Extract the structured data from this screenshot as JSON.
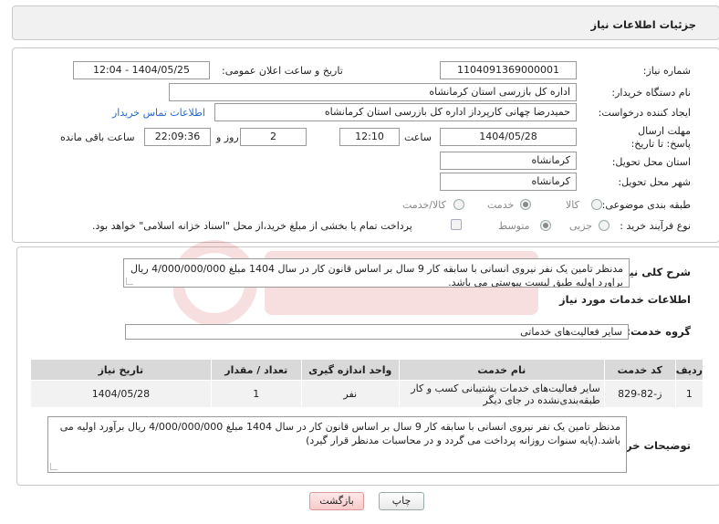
{
  "header": {
    "title": "جزئیات اطلاعات نیاز"
  },
  "form": {
    "need_number_label": "شماره نیاز:",
    "need_number": "1104091369000001",
    "announce_label": "تاریخ و ساعت اعلان عمومی:",
    "announce_value": "1404/05/25 - 12:04",
    "buyer_org_label": "نام دستگاه خریدار:",
    "buyer_org": "اداره کل بازرسی استان کرمانشاه",
    "creator_label": "ایجاد کننده درخواست:",
    "creator": "حمیدرضا چهانی کارپرداز اداره کل بازرسی استان کرمانشاه",
    "contact_link": "اطلاعات تماس خریدار",
    "deadline_label": "مهلت ارسال پاسخ: تا تاریخ:",
    "deadline_date": "1404/05/28",
    "time_label": "ساعت",
    "deadline_time": "12:10",
    "days_value": "2",
    "days_label": "روز و",
    "remaining_time": "22:09:36",
    "remaining_label": "ساعت باقی مانده",
    "province_label": "استان محل تحویل:",
    "province": "کرمانشاه",
    "city_label": "شهر محل تحویل:",
    "city": "کرمانشاه",
    "category_label": "طبقه بندی موضوعی:",
    "category_options": [
      "کالا",
      "خدمت",
      "کالا/خدمت"
    ],
    "category_selected": "خدمت",
    "process_label": "نوع فرآیند خرید :",
    "process_options": [
      "جزیی",
      "متوسط"
    ],
    "process_selected": "متوسط",
    "payment_note": "پرداخت تمام یا بخشی از مبلغ خرید،از محل \"اسناد خزانه اسلامی\" خواهد بود."
  },
  "summary": {
    "label": "شرح کلی نیاز:",
    "text": "مدنظر تامین یک نفر نیروی انسانی با سابقه کار 9 سال بر اساس قانون کار در سال 1404 مبلغ 4/000/000/000 ریال براورد اولیه طبق لیست پیوستی می باشد."
  },
  "services": {
    "section_title": "اطلاعات خدمات مورد نیاز",
    "group_label": "گروه خدمت:",
    "group_value": "سایر فعالیت‌های خدماتی",
    "columns": [
      "ردیف",
      "کد خدمت",
      "نام خدمت",
      "واحد اندازه گیری",
      "تعداد / مقدار",
      "تاریخ نیاز"
    ],
    "rows": [
      [
        "1",
        "ز-82-829",
        "سایر فعالیت‌های خدمات پشتیبانی کسب و کار طبقه‌بندی‌نشده در جای دیگر",
        "نفر",
        "1",
        "1404/05/28"
      ]
    ]
  },
  "buyer_notes": {
    "label": "توضیحات خریدار:",
    "text": "مدنظر تامین یک نفر نیروی انسانی با سابقه کار 9 سال بر اساس قانون کار در سال 1404 مبلغ 4/000/000/000 ریال برآورد اولیه می باشد.(پایه سنوات روزانه پرداخت می گردد و در محاسبات مدنظر قرار گیرد)"
  },
  "buttons": {
    "print": "چاپ",
    "back": "بازگشت"
  },
  "colors": {
    "link": "#2a6ac8",
    "header_bg": "#f1f1f1",
    "table_head": "#d9d9d9"
  }
}
